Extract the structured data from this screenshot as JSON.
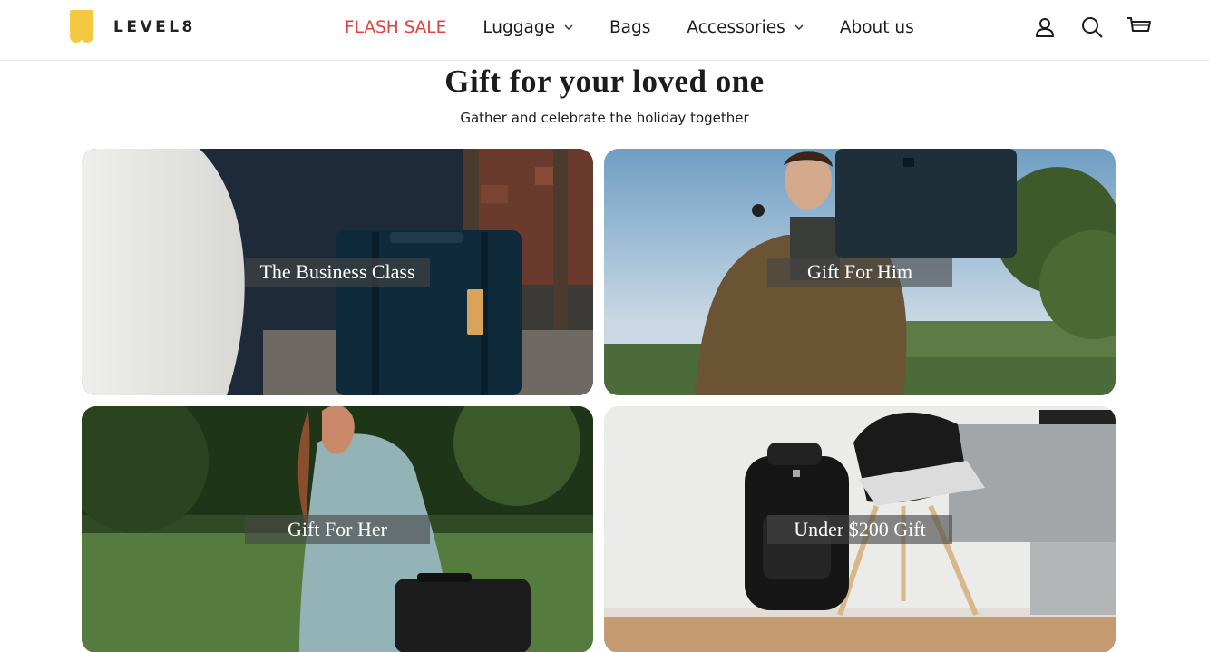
{
  "brand": {
    "name": "LEVEL8",
    "logo_color": "#f5c842"
  },
  "nav": {
    "items": [
      {
        "label": "FLASH SALE",
        "dropdown": false,
        "color": "#e14141"
      },
      {
        "label": "Luggage",
        "dropdown": true
      },
      {
        "label": "Bags",
        "dropdown": false
      },
      {
        "label": "Accessories",
        "dropdown": true
      },
      {
        "label": "About us",
        "dropdown": false
      }
    ]
  },
  "header_icons": [
    "account-icon",
    "search-icon",
    "cart-icon"
  ],
  "section": {
    "title": "Gift for your loved one",
    "subtitle": "Gather and celebrate the holiday together"
  },
  "tiles": [
    {
      "label": "The Business Class",
      "image": "navy-suitcase-photo"
    },
    {
      "label": "Gift For Him",
      "image": "man-with-suitcase-photo"
    },
    {
      "label": "Gift For Her",
      "image": "woman-with-suitcase-photo"
    },
    {
      "label": "Under $200 Gift",
      "image": "backpack-by-chair-photo"
    }
  ]
}
